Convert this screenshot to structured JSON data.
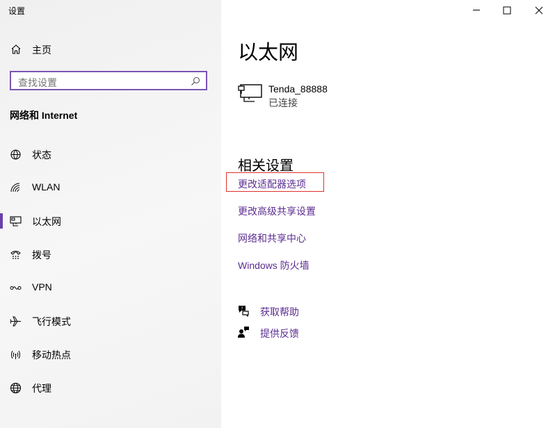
{
  "app": {
    "title": "设置"
  },
  "sidebar": {
    "home_label": "主页",
    "search_placeholder": "查找设置",
    "section_title": "网络和 Internet",
    "items": [
      {
        "label": "状态",
        "icon": "status-icon",
        "selected": false
      },
      {
        "label": "WLAN",
        "icon": "wifi-icon",
        "selected": false
      },
      {
        "label": "以太网",
        "icon": "ethernet-icon",
        "selected": true
      },
      {
        "label": "拨号",
        "icon": "dialup-icon",
        "selected": false
      },
      {
        "label": "VPN",
        "icon": "vpn-icon",
        "selected": false
      },
      {
        "label": "飞行模式",
        "icon": "airplane-icon",
        "selected": false
      },
      {
        "label": "移动热点",
        "icon": "hotspot-icon",
        "selected": false
      },
      {
        "label": "代理",
        "icon": "globe-icon",
        "selected": false
      }
    ]
  },
  "main": {
    "title": "以太网",
    "network": {
      "name": "Tenda_88888",
      "status": "已连接"
    },
    "related_title": "相关设置",
    "related_links": [
      "更改适配器选项",
      "更改高级共享设置",
      "网络和共享中心",
      "Windows 防火墙"
    ],
    "help": {
      "get_help": "获取帮助",
      "feedback": "提供反馈"
    }
  },
  "colors": {
    "accent": "#5c2d91",
    "selection_bar": "#6a3fa8",
    "highlight_box": "#e0302d"
  }
}
